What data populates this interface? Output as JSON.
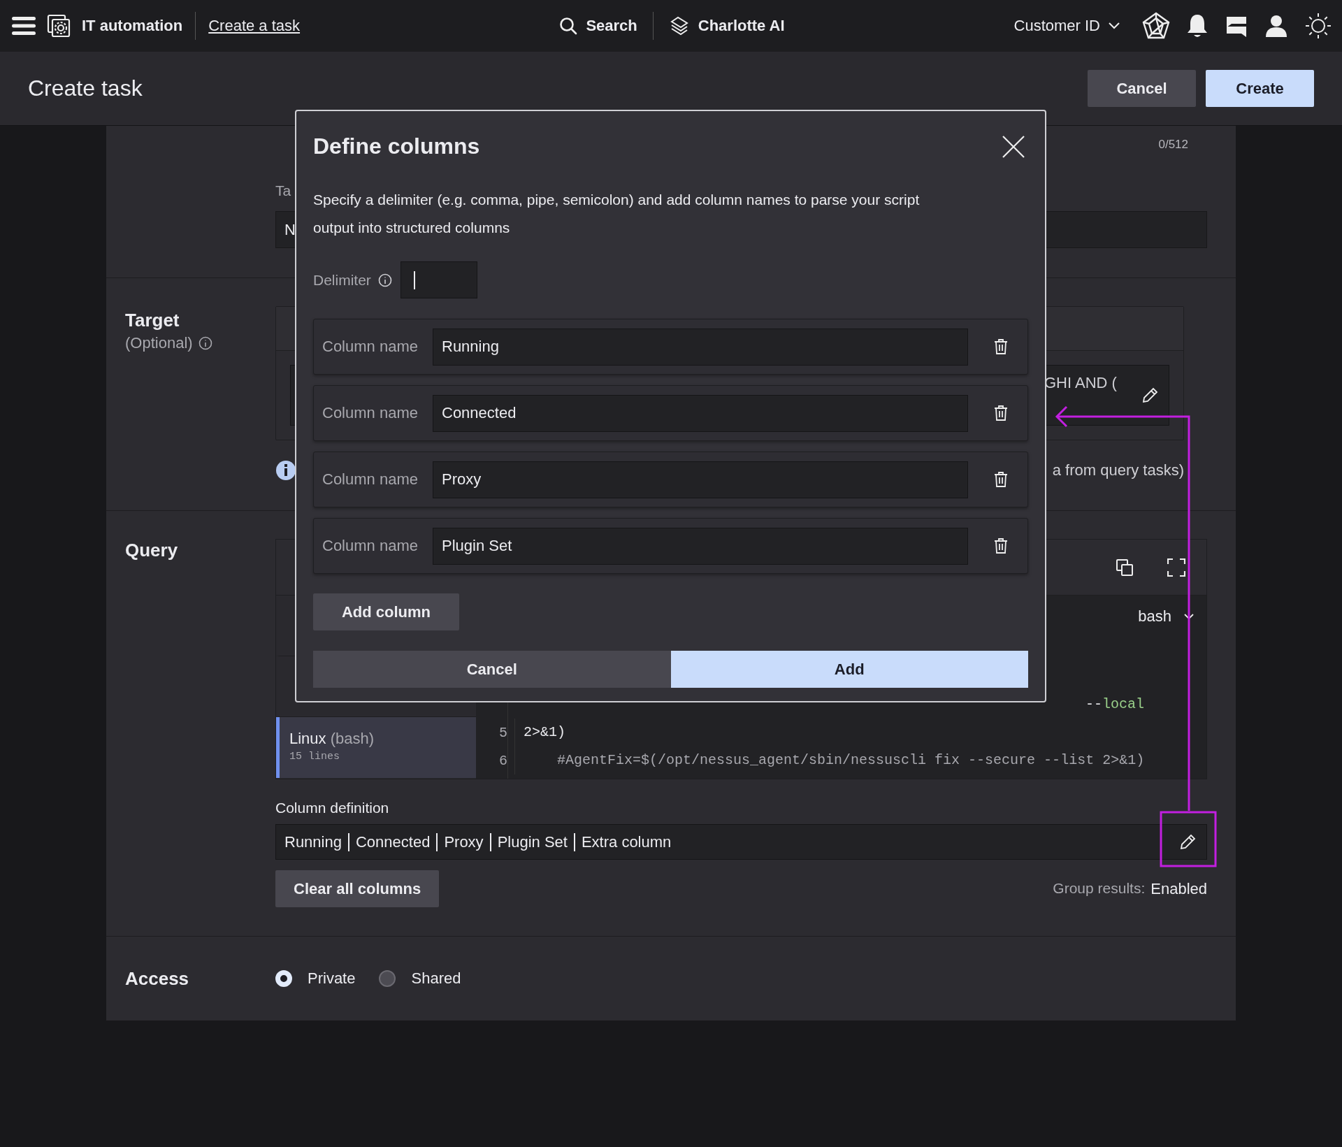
{
  "top_bar": {
    "app_title": "IT automation",
    "breadcrumb": "Create a task",
    "search": "Search",
    "assistant": "Charlotte AI",
    "customer": "Customer ID"
  },
  "header": {
    "title": "Create task",
    "buttons": [
      {
        "label": "Cancel",
        "kind": "secondary"
      },
      {
        "label": "Create",
        "kind": "primary"
      }
    ]
  },
  "task_section": {
    "char_count": "0/512",
    "field_label": "Ta",
    "field_value": "N"
  },
  "target_section": {
    "title": "Target",
    "subtitle": "(Optional)",
    "query_fragment": "GHI AND (",
    "note": "a from query tasks)"
  },
  "query_section": {
    "title": "Query",
    "scripts": [
      {
        "selected": false
      },
      {
        "selected": false
      },
      {
        "name": "Linux",
        "lang": "(bash)",
        "meta": "15 lines",
        "selected": true
      }
    ],
    "language": "bash",
    "code_lines": [
      {
        "tokens": [
          {
            "text": "--",
            "kind": "plain"
          },
          {
            "text": "local",
            "kind": "keyword"
          }
        ]
      },
      {
        "number": "5",
        "tokens": [
          {
            "text": "2>&1)",
            "kind": "plain"
          }
        ]
      },
      {
        "number": "6",
        "tokens": [
          {
            "text": "    #AgentFix=$(/opt/nessus_agent/sbin/nessuscli fix --secure --list 2>&1)",
            "kind": "comment"
          }
        ]
      }
    ],
    "column_definition": {
      "label": "Column definition",
      "columns": [
        "Running",
        "Connected",
        "Proxy",
        "Plugin Set",
        "Extra column"
      ]
    },
    "clear_button": "Clear all columns",
    "group_results": {
      "label": "Group results:",
      "value": "Enabled"
    }
  },
  "access": {
    "title": "Access",
    "options": [
      {
        "label": "Private",
        "selected": true
      },
      {
        "label": "Shared",
        "selected": false
      }
    ]
  },
  "dialog": {
    "title": "Define columns",
    "description": "Specify a delimiter (e.g. comma, pipe, semicolon) and add column names to parse your script output into structured columns",
    "delimiter_label": "Delimiter",
    "rows": [
      {
        "label": "Column name",
        "value": "Running"
      },
      {
        "label": "Column name",
        "value": "Connected"
      },
      {
        "label": "Column name",
        "value": "Proxy"
      },
      {
        "label": "Column name",
        "value": "Plugin Set"
      }
    ],
    "add_column": "Add column",
    "buttons": [
      {
        "label": "Cancel",
        "kind": "secondary"
      },
      {
        "label": "Add",
        "kind": "primary"
      }
    ]
  }
}
